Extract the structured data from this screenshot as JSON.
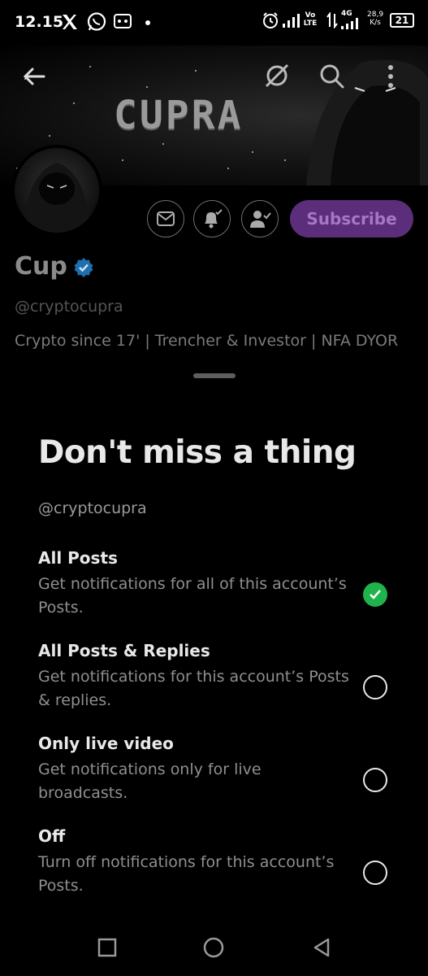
{
  "status_bar": {
    "time": "12.15",
    "network_speed": "28,9",
    "network_speed_unit": "K/s",
    "battery": "21",
    "lte_label": "Vo LTE",
    "net_type": "4G"
  },
  "banner": {
    "title": "CUPRA"
  },
  "profile": {
    "subscribe_label": "Subscribe",
    "name": "Cup",
    "handle": "@cryptocupra",
    "bio": "Crypto since 17' | Trencher & Investor | NFA DYOR"
  },
  "sheet": {
    "title": "Don't miss a thing",
    "handle": "@cryptocupra",
    "options": [
      {
        "title": "All Posts",
        "desc": "Get notifications for all of this account’s Posts.",
        "selected": true
      },
      {
        "title": "All Posts & Replies",
        "desc": "Get notifications for this account’s Posts & replies.",
        "selected": false
      },
      {
        "title": "Only live video",
        "desc": "Get notifications only for live broadcasts.",
        "selected": false
      },
      {
        "title": "Off",
        "desc": "Turn off notifications for this account’s Posts.",
        "selected": false
      }
    ]
  },
  "colors": {
    "accent_purple": "#5c2d7a",
    "check_green": "#1fb34b",
    "verified_blue": "#1d9bf0"
  }
}
